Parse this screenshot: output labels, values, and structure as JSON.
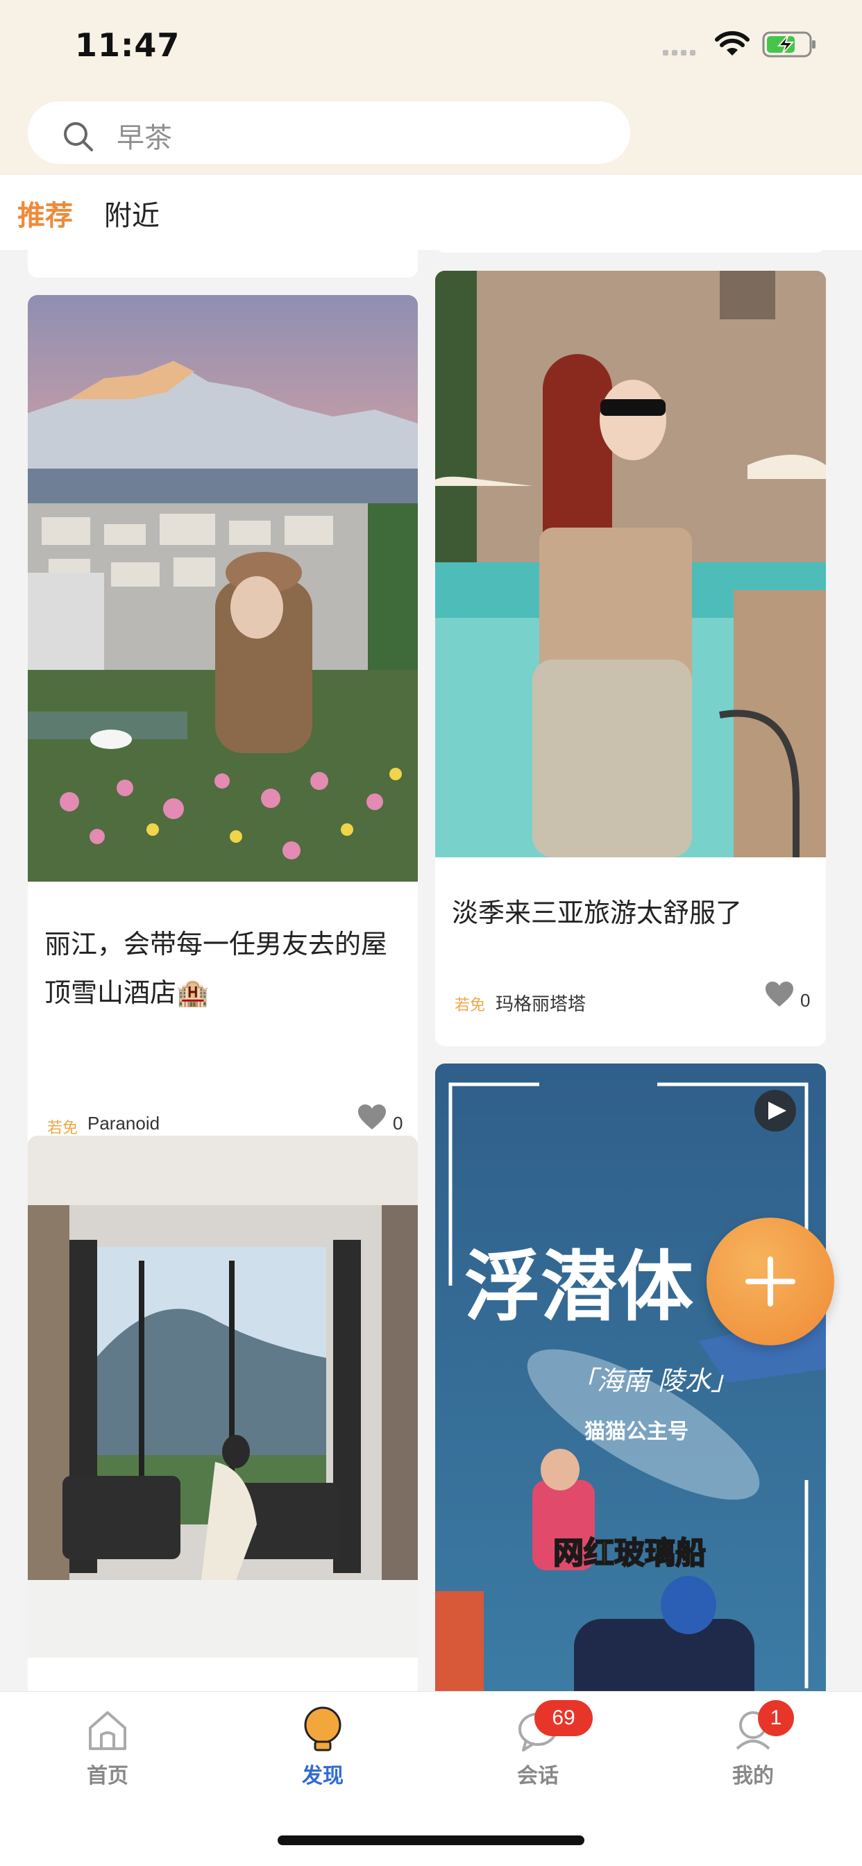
{
  "status": {
    "time": "11:47"
  },
  "search": {
    "placeholder": "早茶"
  },
  "tabs": [
    {
      "label": "推荐",
      "active": true
    },
    {
      "label": "附近",
      "active": false
    }
  ],
  "cards": [
    {
      "title_line1": "丽江，会带每一任男友去的屋",
      "title_line2": "顶雪山酒店🏨",
      "tag": "若免",
      "author": "Paranoid",
      "likes": "0"
    },
    {
      "title": "淡季来三亚旅游太舒服了",
      "tag": "若免",
      "author": "玛格丽塔塔",
      "likes": "0"
    },
    {
      "image_text": {
        "big": "浮潜体",
        "location": "「海南 陵水」",
        "account": "猫猫公主号",
        "caption": "网红玻璃船"
      }
    }
  ],
  "nav": [
    {
      "label": "首页",
      "icon": "home-icon"
    },
    {
      "label": "发现",
      "icon": "lightbulb-icon",
      "active": true
    },
    {
      "label": "会话",
      "icon": "chat-icon",
      "badge": "69"
    },
    {
      "label": "我的",
      "icon": "profile-icon",
      "badge": "1"
    }
  ],
  "colors": {
    "accent": "#ef8a3a",
    "nav_active": "#2f6bd8",
    "badge": "#e8352a",
    "top_bg": "#f8f1e6"
  }
}
